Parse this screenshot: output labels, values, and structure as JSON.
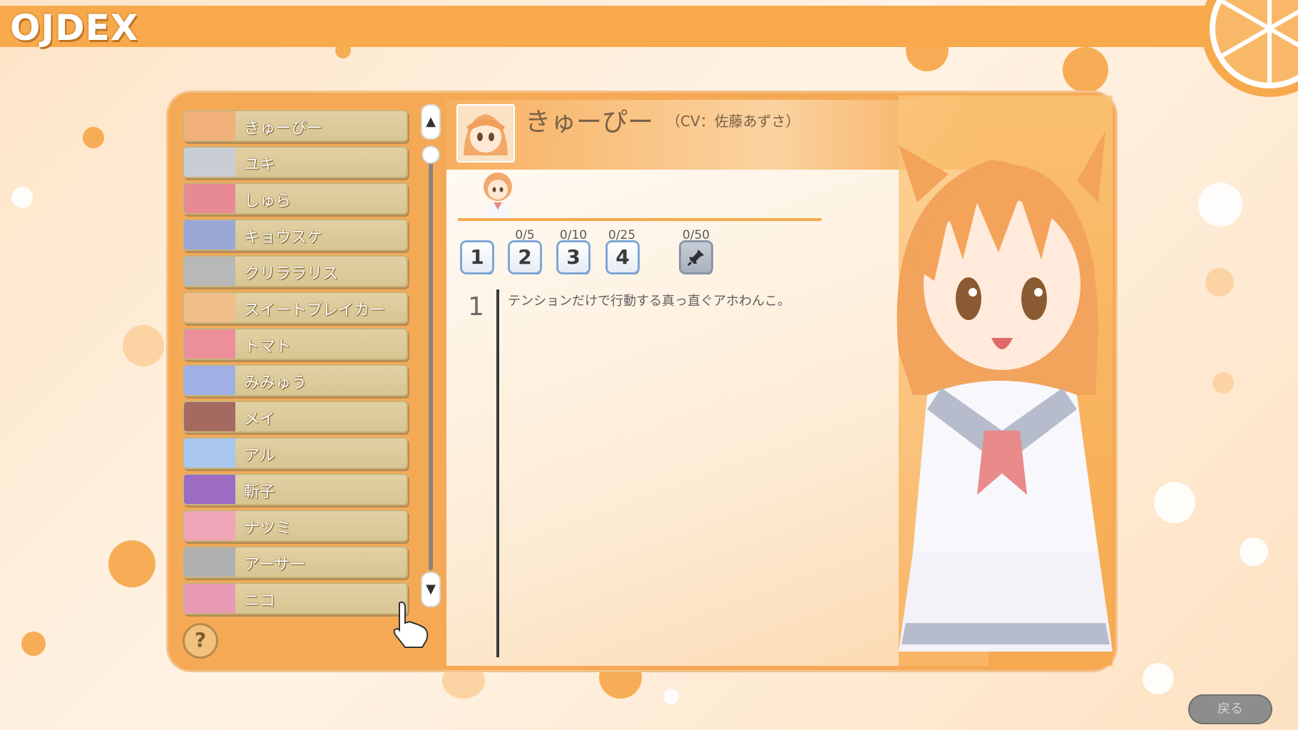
{
  "app": {
    "logo": "OJDEX"
  },
  "colors": {
    "accent": "#f7a94c",
    "list_item": "#d7c592",
    "level_border": "#7fa6d6"
  },
  "characters": [
    {
      "name": "きゅーぴー",
      "thumb_color": "#f2b07b"
    },
    {
      "name": "ユキ",
      "thumb_color": "#c9ced6"
    },
    {
      "name": "しゅら",
      "thumb_color": "#e88a93"
    },
    {
      "name": "キョウスケ",
      "thumb_color": "#9aa8d8"
    },
    {
      "name": "クリララリス",
      "thumb_color": "#b8b8b8"
    },
    {
      "name": "スイートブレイカー",
      "thumb_color": "#f1c08a"
    },
    {
      "name": "トマト",
      "thumb_color": "#ec8f9a"
    },
    {
      "name": "みみゅう",
      "thumb_color": "#9fb0e4"
    },
    {
      "name": "メイ",
      "thumb_color": "#a46a60"
    },
    {
      "name": "アル",
      "thumb_color": "#a9c6ee"
    },
    {
      "name": "斬子",
      "thumb_color": "#9c6bc4"
    },
    {
      "name": "ナツミ",
      "thumb_color": "#f0a6b8"
    },
    {
      "name": "アーサー",
      "thumb_color": "#b0b0b0"
    },
    {
      "name": "ニコ",
      "thumb_color": "#e99ab5"
    }
  ],
  "scroll": {
    "up_label": "▲",
    "down_label": "▼"
  },
  "help_label": "?",
  "detail": {
    "name": "きゅーぴー",
    "cv": "（CV：佐藤あずさ）",
    "levels": [
      {
        "label": "1",
        "count": ""
      },
      {
        "label": "2",
        "count": "0/5"
      },
      {
        "label": "3",
        "count": "0/10"
      },
      {
        "label": "4",
        "count": "0/25"
      },
      {
        "label": "📌",
        "count": "0/50"
      }
    ],
    "entry_number": "1",
    "entry_text": "テンションだけで行動する真っ直ぐアホわんこ。"
  },
  "back_label": "戻る"
}
